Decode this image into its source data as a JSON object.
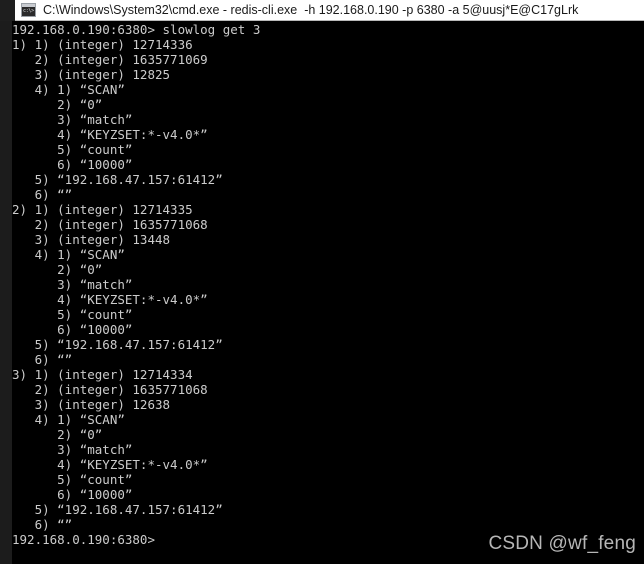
{
  "window": {
    "title": "C:\\Windows\\System32\\cmd.exe - redis-cli.exe  -h 192.168.0.190 -p 6380 -a 5@uusj*E@C17gLrk",
    "icon": "cmd-console-icon"
  },
  "colors": {
    "titlebar_background": "#ffffff",
    "titlebar_text": "#1a1a1a",
    "console_background": "#000000",
    "console_text": "#cccccc",
    "gutter": "#1c1c1c",
    "watermark_text": "#b6b6b6"
  },
  "console": {
    "lines": [
      "192.168.0.190:6380> slowlog get 3",
      "1) 1) (integer) 12714336",
      "   2) (integer) 1635771069",
      "   3) (integer) 12825",
      "   4) 1) “SCAN”",
      "      2) “0”",
      "      3) “match”",
      "      4) “KEYZSET:*-v4.0*”",
      "      5) “count”",
      "      6) “10000”",
      "   5) “192.168.47.157:61412”",
      "   6) “”",
      "2) 1) (integer) 12714335",
      "   2) (integer) 1635771068",
      "   3) (integer) 13448",
      "   4) 1) “SCAN”",
      "      2) “0”",
      "      3) “match”",
      "      4) “KEYZSET:*-v4.0*”",
      "      5) “count”",
      "      6) “10000”",
      "   5) “192.168.47.157:61412”",
      "   6) “”",
      "3) 1) (integer) 12714334",
      "   2) (integer) 1635771068",
      "   3) (integer) 12638",
      "   4) 1) “SCAN”",
      "      2) “0”",
      "      3) “match”",
      "      4) “KEYZSET:*-v4.0*”",
      "      5) “count”",
      "      6) “10000”",
      "   5) “192.168.47.157:61412”",
      "   6) “”",
      "192.168.0.190:6380>"
    ],
    "command": "slowlog get 3",
    "prompt": "192.168.0.190:6380>",
    "entries": [
      {
        "index": "1)",
        "id": "12714336",
        "timestamp": "1635771069",
        "duration_us": "12825",
        "args": [
          "SCAN",
          "0",
          "match",
          "KEYZSET:*-v4.0*",
          "count",
          "10000"
        ],
        "client_addr": "192.168.47.157:61412",
        "client_name": ""
      },
      {
        "index": "2)",
        "id": "12714335",
        "timestamp": "1635771068",
        "duration_us": "13448",
        "args": [
          "SCAN",
          "0",
          "match",
          "KEYZSET:*-v4.0*",
          "count",
          "10000"
        ],
        "client_addr": "192.168.47.157:61412",
        "client_name": ""
      },
      {
        "index": "3)",
        "id": "12714334",
        "timestamp": "1635771068",
        "duration_us": "12638",
        "args": [
          "SCAN",
          "0",
          "match",
          "KEYZSET:*-v4.0*",
          "count",
          "10000"
        ],
        "client_addr": "192.168.47.157:61412",
        "client_name": ""
      }
    ]
  },
  "watermark": {
    "text": "CSDN @wf_feng"
  }
}
